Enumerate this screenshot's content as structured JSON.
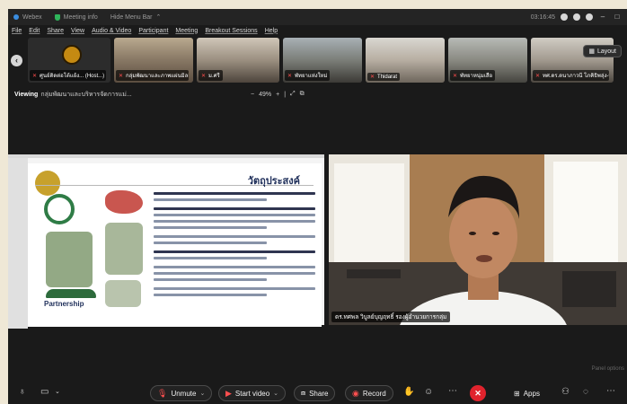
{
  "titlebar": {
    "app_name": "Webex",
    "meeting_info": "Meeting info",
    "hide_menu": "Hide Menu Bar",
    "time": "03:16:45"
  },
  "menu": [
    "File",
    "Edit",
    "Share",
    "View",
    "Audio & Video",
    "Participant",
    "Meeting",
    "Breakout Sessions",
    "Help"
  ],
  "gallery": {
    "thumbnails": [
      {
        "label": "ศูนย์ติดต่อโต้แย้ง... (Host...)",
        "muted": true
      },
      {
        "label": "กลุ่มพัฒนาและภาพแผ่นมิลลิ...",
        "muted": true
      },
      {
        "label": "ม.ศรี",
        "muted": true
      },
      {
        "label": "พัทยาแห่งใหม่",
        "muted": true
      },
      {
        "label": "Thidarat",
        "muted": true
      },
      {
        "label": "พัทยาหนุ่มเสือ",
        "muted": true
      },
      {
        "label": "ทศ.ดร.ดนาภาวนี โภคิธิพลุ่ง-บ.ช.",
        "muted": true
      }
    ],
    "layout_label": "Layout"
  },
  "viewing": {
    "prefix": "Viewing",
    "text": "กลุ่มพัฒนาและบริหารจัดการแม่...",
    "zoom": "49%"
  },
  "shared_slide": {
    "heading": "วัตถุประสงค์",
    "partner_text": "Partnership"
  },
  "video": {
    "speaker_name": "ดร.ทศพล วิบูลย์บุญฤทธิ์ รองผู้อำนวยการกลุ่ม"
  },
  "footer_note": "Panel options",
  "toolbar": {
    "unmute": "Unmute",
    "start_video": "Start video",
    "share": "Share",
    "record": "Record",
    "apps": "Apps"
  },
  "colors": {
    "leave": "#e0232d",
    "muted_icon": "#ff4f4f",
    "accent_blue": "#3a8de0"
  }
}
